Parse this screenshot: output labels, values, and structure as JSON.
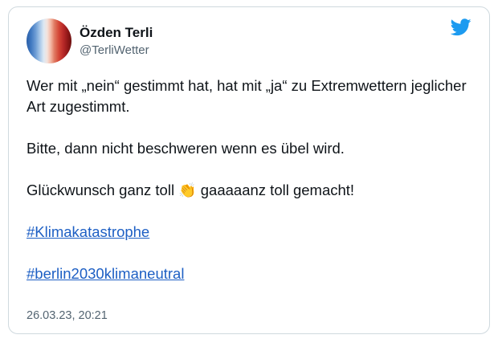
{
  "tweet": {
    "author_name": "Özden Terli",
    "author_handle": "@TerliWetter",
    "line1": "Wer mit „nein“ gestimmt hat, hat mit „ja“ zu Extremwettern jeglicher Art zugestimmt.",
    "line2": "Bitte, dann nicht beschweren wenn es übel wird.",
    "line3_before": "Glückwunsch ganz toll",
    "line3_emoji": "👏",
    "line3_after": "gaaaaanz toll gemacht!",
    "hashtag1": "#Klimakatastrophe",
    "hashtag2": "#berlin2030klimaneutral",
    "timestamp": "26.03.23, 20:21"
  },
  "icons": {
    "brand": "twitter-bird-icon",
    "brand_color": "#1d9bf0"
  },
  "colors": {
    "link": "#1d5fc4",
    "muted": "#536471",
    "border": "#cfd9de"
  }
}
